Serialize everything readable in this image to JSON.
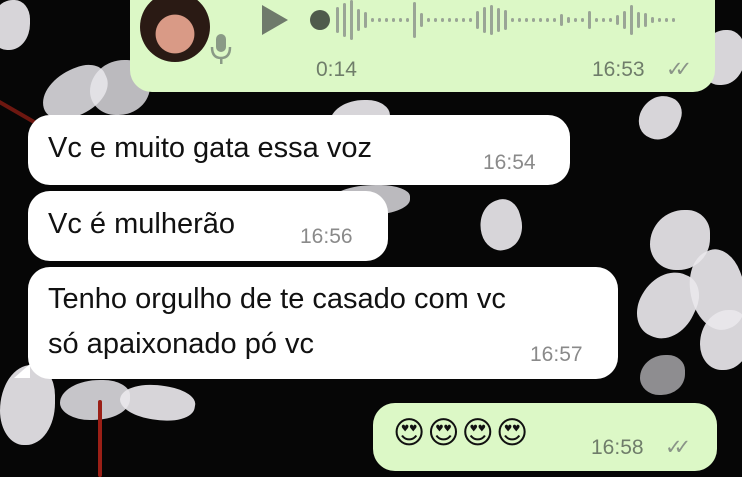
{
  "chat": {
    "voice_message": {
      "duration": "0:14",
      "time": "16:53",
      "status": "read",
      "status_icon": "double-check-icon",
      "colors": {
        "bubble": "#dcf8c6",
        "waveform": "#9aa596",
        "play": "#6f7a6b"
      }
    },
    "messages": [
      {
        "direction": "incoming",
        "lines": [
          "Vc e muito gata essa voz"
        ],
        "time": "16:54"
      },
      {
        "direction": "incoming",
        "lines": [
          "Vc é  mulherão"
        ],
        "time": "16:56"
      },
      {
        "direction": "incoming",
        "lines": [
          "Tenho orgulho de te casado com vc",
          "só apaixonado pó vc"
        ],
        "time": "16:57"
      },
      {
        "direction": "outgoing",
        "emoji": "😍😍😍😍",
        "time": "16:58",
        "status": "read"
      }
    ],
    "colors": {
      "incoming_bubble": "#ffffff",
      "outgoing_bubble": "#dcf8c6",
      "background": "#060606"
    }
  }
}
